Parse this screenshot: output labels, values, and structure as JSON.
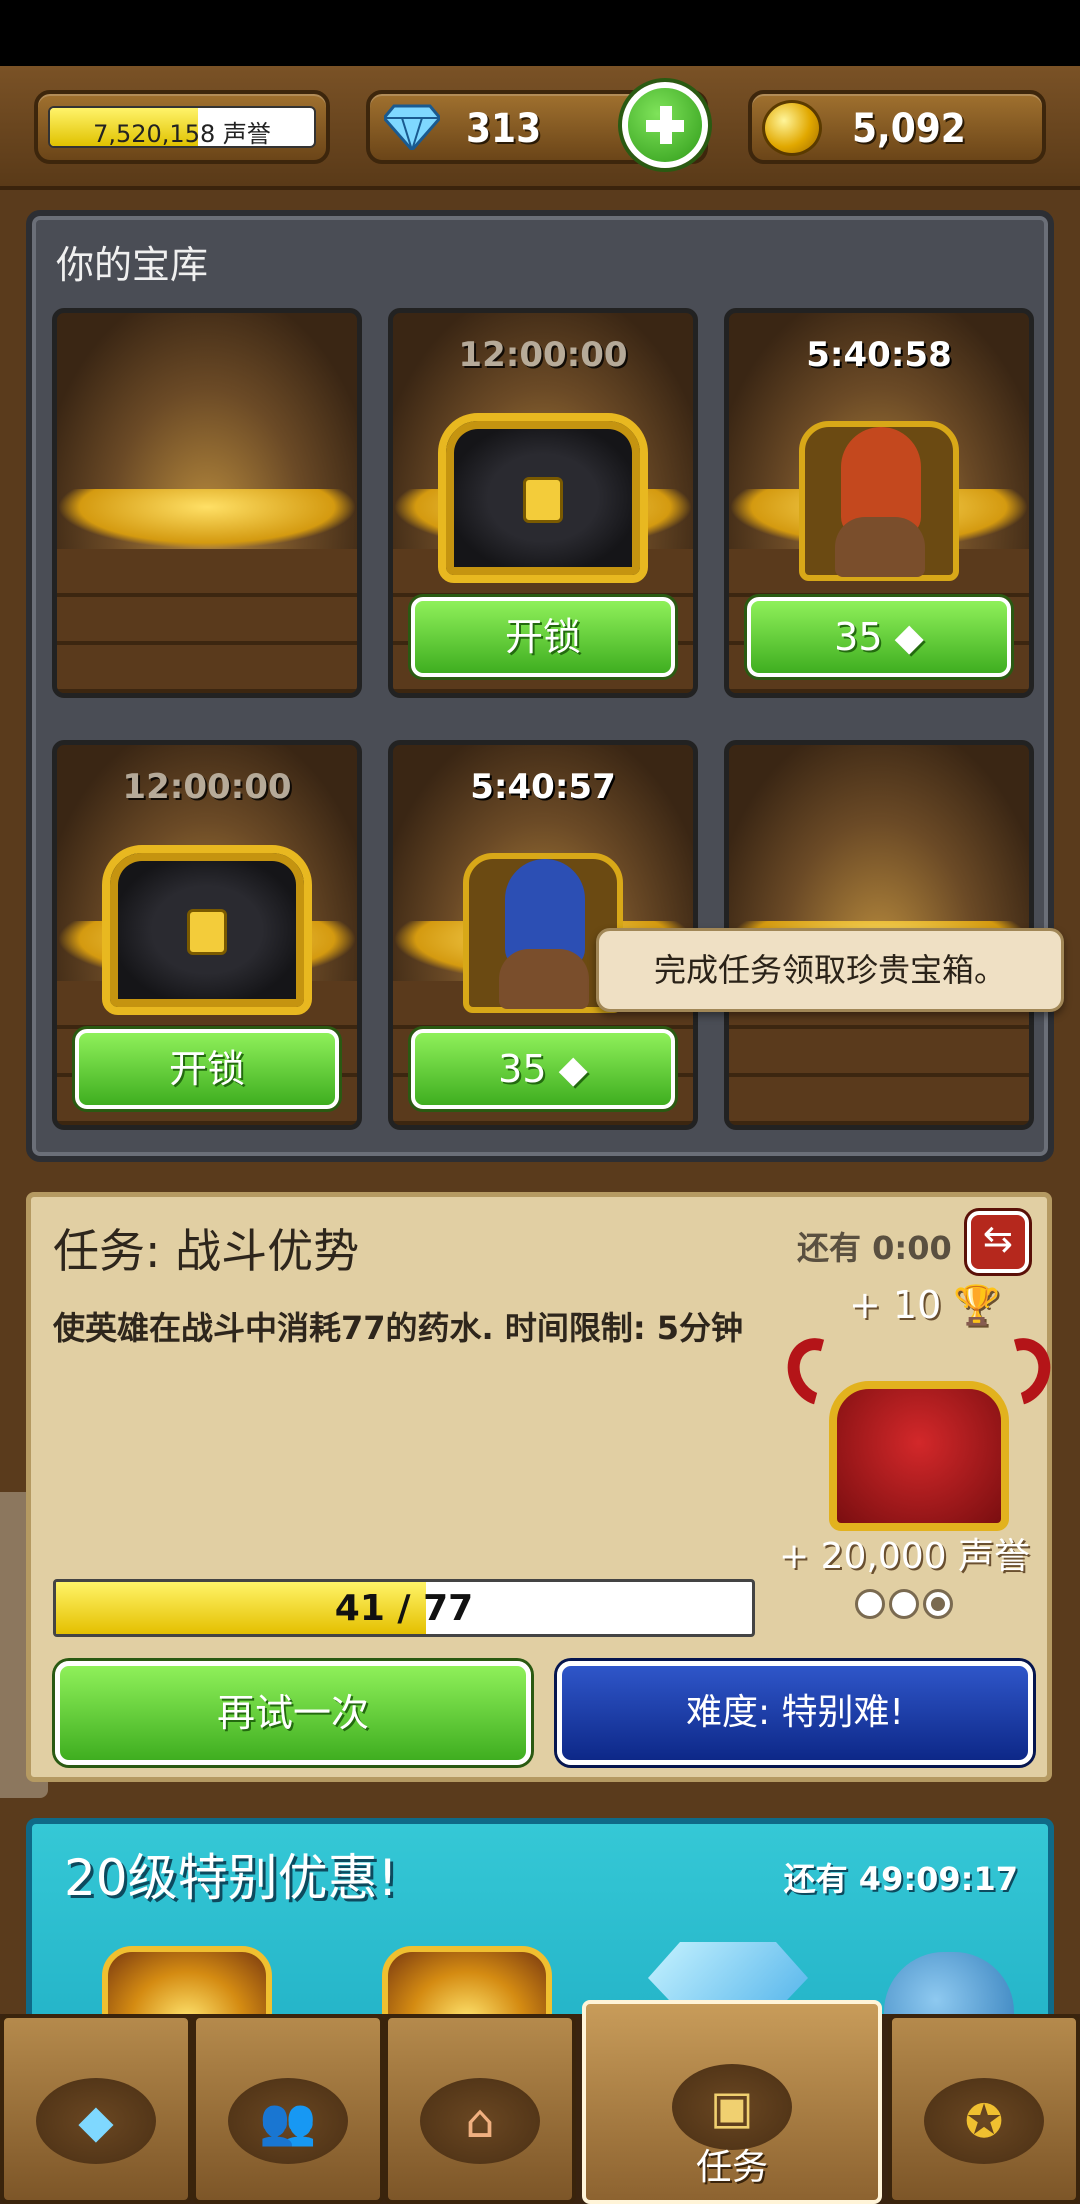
{
  "topbar": {
    "fame_value": "7,520,158",
    "fame_label": "声誉",
    "fame_bar_fraction": 0.56,
    "gems": "313",
    "gold": "5,092"
  },
  "vault": {
    "title": "你的宝库",
    "slots": [
      {
        "state": "empty",
        "timer": "",
        "button": ""
      },
      {
        "state": "locked-chest",
        "timer": "12:00:00",
        "button": "开锁"
      },
      {
        "state": "goblin-chest",
        "timer": "5:40:58",
        "button": "35"
      },
      {
        "state": "locked-chest",
        "timer": "12:00:00",
        "button": "开锁"
      },
      {
        "state": "goblin-chest",
        "timer": "5:40:57",
        "button": "35"
      },
      {
        "state": "empty",
        "timer": "",
        "button": ""
      }
    ],
    "tooltip": "完成任务领取珍贵宝箱。"
  },
  "quest": {
    "title": "任务: 战斗优势",
    "remaining": "还有 0:00",
    "description": "使英雄在战斗中消耗77的药水. 时间限制: 5分钟",
    "trophy_reward": "+ 10",
    "fame_reward": "+ 20,000 声誉",
    "progress_text": "41 / 77",
    "progress_fraction": 0.532,
    "retry_label": "再试一次",
    "difficulty_label": "难度: 特别难!",
    "difficulty_dots": [
      false,
      false,
      true
    ]
  },
  "offer": {
    "title": "20级特别优惠!",
    "remaining": "还有 49:09:17"
  },
  "nav": {
    "tabs": [
      {
        "icon": "gems-icon",
        "label": ""
      },
      {
        "icon": "heroes-icon",
        "label": ""
      },
      {
        "icon": "town-icon",
        "label": ""
      },
      {
        "icon": "chest-icon",
        "label": "任务"
      },
      {
        "icon": "medal-icon",
        "label": ""
      }
    ],
    "active": 3
  },
  "colors": {
    "button_green": "#3fae20",
    "button_blue": "#0d2888",
    "progress_yellow": "#e4c000",
    "panel_parchment": "#e1cfa3"
  }
}
